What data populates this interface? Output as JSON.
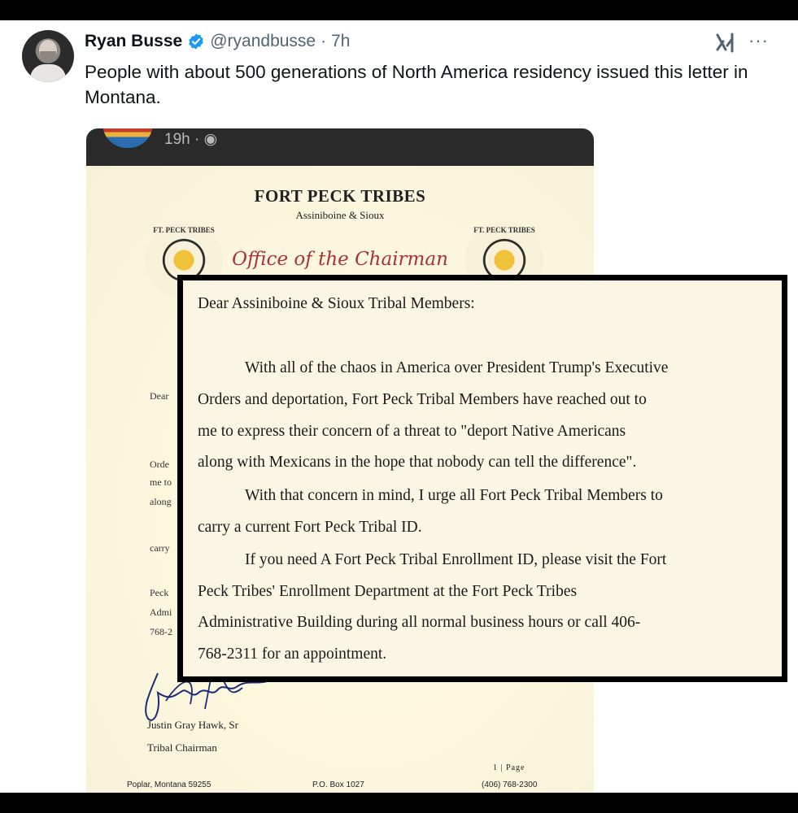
{
  "tweet": {
    "author_name": "Ryan Busse",
    "handle": "@ryandbusse",
    "separator": "·",
    "time": "7h",
    "text": "People with about 500 generations of North America residency issued this letter in Montana.",
    "more": "···",
    "icons": [
      "verified-badge-icon",
      "grok-icon",
      "more-options-icon"
    ]
  },
  "embed": {
    "time": "19h ·",
    "letter": {
      "org_title": "FORT PECK TRIBES",
      "org_sub": "Assiniboine & Sioux",
      "office": "Office of the Chairman",
      "seal_text": "FT. PECK TRIBES",
      "fragments": [
        "Dear",
        "Orde",
        "me to",
        "along",
        "carry",
        "Peck",
        "Admi",
        "768-2"
      ],
      "signer_name": "Justin Gray Hawk, Sr",
      "signer_title": "Tribal Chairman",
      "page": "1 | Page",
      "footer_left": "Poplar, Montana 59255",
      "footer_mid": "P.O. Box 1027",
      "footer_right": "(406) 768-2300"
    }
  },
  "zoom": {
    "lines": [
      "Dear Assiniboine & Sioux Tribal Members:",
      "With all of the chaos in America over President Trump's Executive",
      "Orders and deportation, Fort Peck Tribal Members have reached out to",
      "me to express their concern of a threat to \"deport Native Americans",
      "along with Mexicans in the hope that nobody can tell the difference\".",
      "With that concern in mind, I urge all Fort Peck Tribal Members to",
      "carry a current Fort Peck Tribal ID.",
      "If you need A Fort Peck Tribal Enrollment ID, please visit the Fort",
      "Peck Tribes' Enrollment Department at the Fort Peck Tribes",
      "Administrative Building during all normal business hours or call 406-",
      "768-2311 for an appointment."
    ]
  },
  "colors": {
    "verified_blue": "#1d9bf0",
    "secondary_text": "#536471",
    "office_red": "#a8323a"
  }
}
